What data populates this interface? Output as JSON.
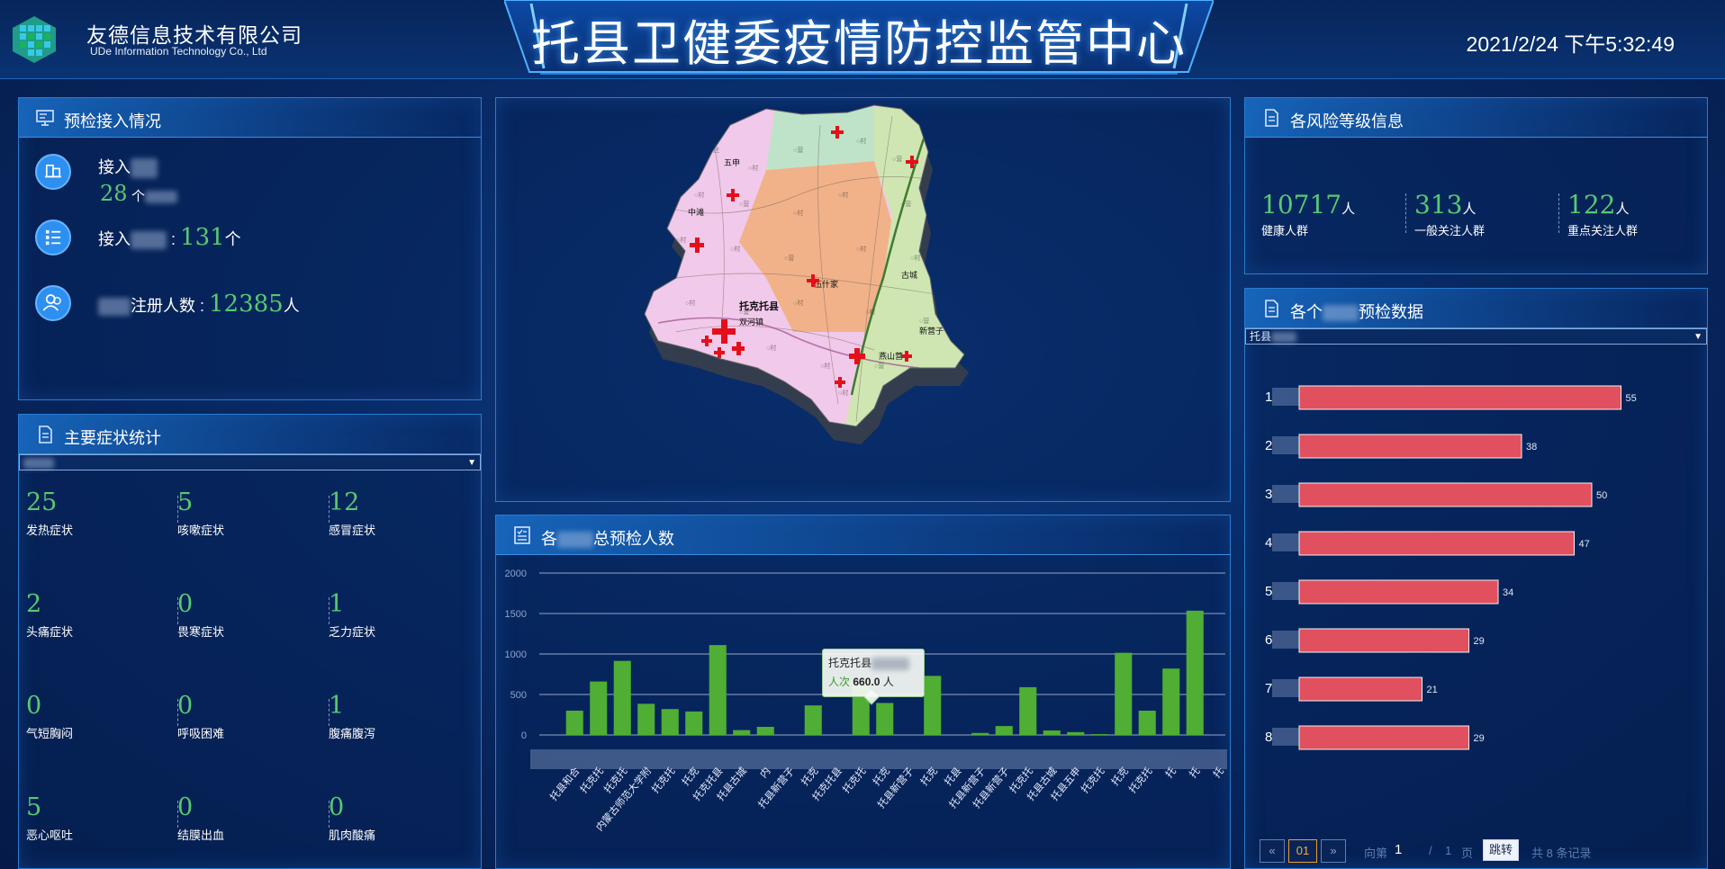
{
  "header": {
    "company_name": "友德信息技术有限公司",
    "company_en": "UDe Information Technology Co., Ltd",
    "title": "托县卫健委疫情防控监管中心",
    "datetime": "2021/2/24 下午5:32:49"
  },
  "precheck_panel": {
    "title": "预检接入情况",
    "row1_label": "接入",
    "row1_value": "28",
    "row1_unit": "个",
    "row2_label": "接入",
    "row2_value": "131",
    "row2_unit": "个",
    "row3_label": "注册人数 : ",
    "row3_value": "12385",
    "row3_unit": "人"
  },
  "symptom_panel": {
    "title": "主要症状统计",
    "items": [
      {
        "value": "25",
        "label": "发热症状"
      },
      {
        "value": "5",
        "label": "咳嗽症状"
      },
      {
        "value": "12",
        "label": "感冒症状"
      },
      {
        "value": "2",
        "label": "头痛症状"
      },
      {
        "value": "0",
        "label": "畏寒症状"
      },
      {
        "value": "1",
        "label": "乏力症状"
      },
      {
        "value": "0",
        "label": "气短胸闷"
      },
      {
        "value": "0",
        "label": "呼吸困难"
      },
      {
        "value": "1",
        "label": "腹痛腹泻"
      },
      {
        "value": "5",
        "label": "恶心呕吐"
      },
      {
        "value": "0",
        "label": "结膜出血"
      },
      {
        "value": "0",
        "label": "肌肉酸痛"
      }
    ]
  },
  "map_panel": {
    "labels": [
      "双河镇",
      "托克托县",
      "伍什家",
      "五申",
      "新营子",
      "燕山营",
      "古城",
      "中滩"
    ],
    "colors": {
      "west": "#f1c9ea",
      "center": "#f1b28a",
      "east": "#cfe6b3",
      "north": "#bfe3c8"
    }
  },
  "risk_panel": {
    "title": "各风险等级信息",
    "items": [
      {
        "value": "10717",
        "unit": "人",
        "label": "健康人群"
      },
      {
        "value": "313",
        "unit": "人",
        "label": "一般关注人群"
      },
      {
        "value": "122",
        "unit": "人",
        "label": "重点关注人群"
      }
    ]
  },
  "site_panel": {
    "title_a": "各个",
    "title_b": "预检数据",
    "select_value": "托县",
    "chart_data": {
      "type": "bar",
      "categories": [
        "1",
        "2",
        "3",
        "4",
        "5",
        "6",
        "7",
        "8"
      ],
      "values": [
        55,
        38,
        50,
        47,
        34,
        29,
        21,
        29
      ],
      "xlim": [
        0,
        60
      ],
      "color": "#e0505f"
    },
    "pager": {
      "prev": "«",
      "current": "01",
      "next": "»",
      "goto_prefix": "向第",
      "goto_value": "1",
      "slash": "/",
      "total_pages": "1",
      "page_unit": "页",
      "jump": "跳转",
      "total_text": "共 8 条记录"
    }
  },
  "town_panel": {
    "title_a": "各",
    "title_b": "总预检人数",
    "tooltip_title": "托克托县",
    "tooltip_series": "人次",
    "tooltip_value": "660.0",
    "tooltip_unit": "人",
    "chart_data": {
      "type": "bar",
      "yticks": [
        "0",
        "500",
        "1000",
        "1500",
        "2000"
      ],
      "ylim": [
        0,
        2000
      ],
      "x_labels": [
        "托县和合",
        "托克托",
        "托克托",
        "内蒙古师范大学附",
        "托克托",
        "托克",
        "托克托县",
        "托县古城",
        "内",
        "托县新营子",
        "托克",
        "托克托县",
        "托克托",
        "托克",
        "托县新营子",
        "托克",
        "托县",
        "托县新营子",
        "托县新营子",
        "托克托",
        "托县古城",
        "托县五申",
        "托克托",
        "托克",
        "托克托",
        "托",
        "托",
        "托"
      ],
      "values": [
        300,
        660,
        915,
        385,
        320,
        290,
        1110,
        60,
        100,
        0,
        365,
        0,
        660,
        395,
        0,
        730,
        0,
        25,
        110,
        590,
        55,
        35,
        10,
        1015,
        300,
        820,
        1535,
        0
      ],
      "color": "#4fae33"
    }
  }
}
